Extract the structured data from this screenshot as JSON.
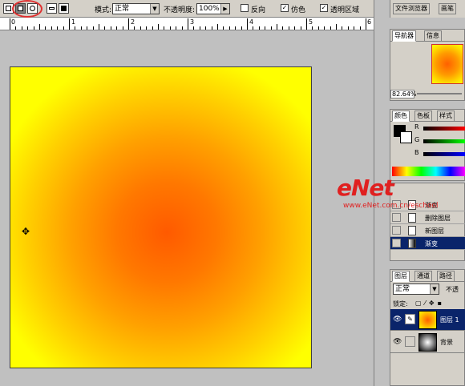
{
  "options_bar": {
    "mode_label": "模式:",
    "mode_value": "正常",
    "opacity_label": "不透明度:",
    "opacity_value": "100%",
    "reverse_label": "反向",
    "dither_label": "仿色",
    "transparency_label": "透明区域"
  },
  "palette_well": {
    "tabs": [
      "文件浏览器",
      "画笔"
    ]
  },
  "ruler": {
    "marks": [
      "0",
      "1",
      "2",
      "3",
      "4",
      "5",
      "6"
    ]
  },
  "navigator": {
    "tabs": [
      "导航器",
      "信息"
    ],
    "zoom": "82.64%"
  },
  "color_panel": {
    "tabs": [
      "颜色",
      "色板",
      "样式"
    ],
    "channels": [
      "R",
      "G",
      "B"
    ],
    "accent": "#ff6000"
  },
  "history_panel": {
    "items": [
      {
        "label": "渐变",
        "selected": false
      },
      {
        "label": "删除图层",
        "selected": false
      },
      {
        "label": "新图层",
        "selected": false
      },
      {
        "label": "渐变",
        "selected": true
      }
    ]
  },
  "layers_panel": {
    "tabs": [
      "图层",
      "通道",
      "路径"
    ],
    "blend_mode": "正常",
    "opacity_label": "不透",
    "lock_label": "锁定:",
    "layers": [
      {
        "name": "图层 1",
        "selected": true
      },
      {
        "name": "背景",
        "selected": false
      }
    ]
  },
  "watermark": {
    "logo": "eNet",
    "url": "www.eNet.com.cn/eschool"
  }
}
